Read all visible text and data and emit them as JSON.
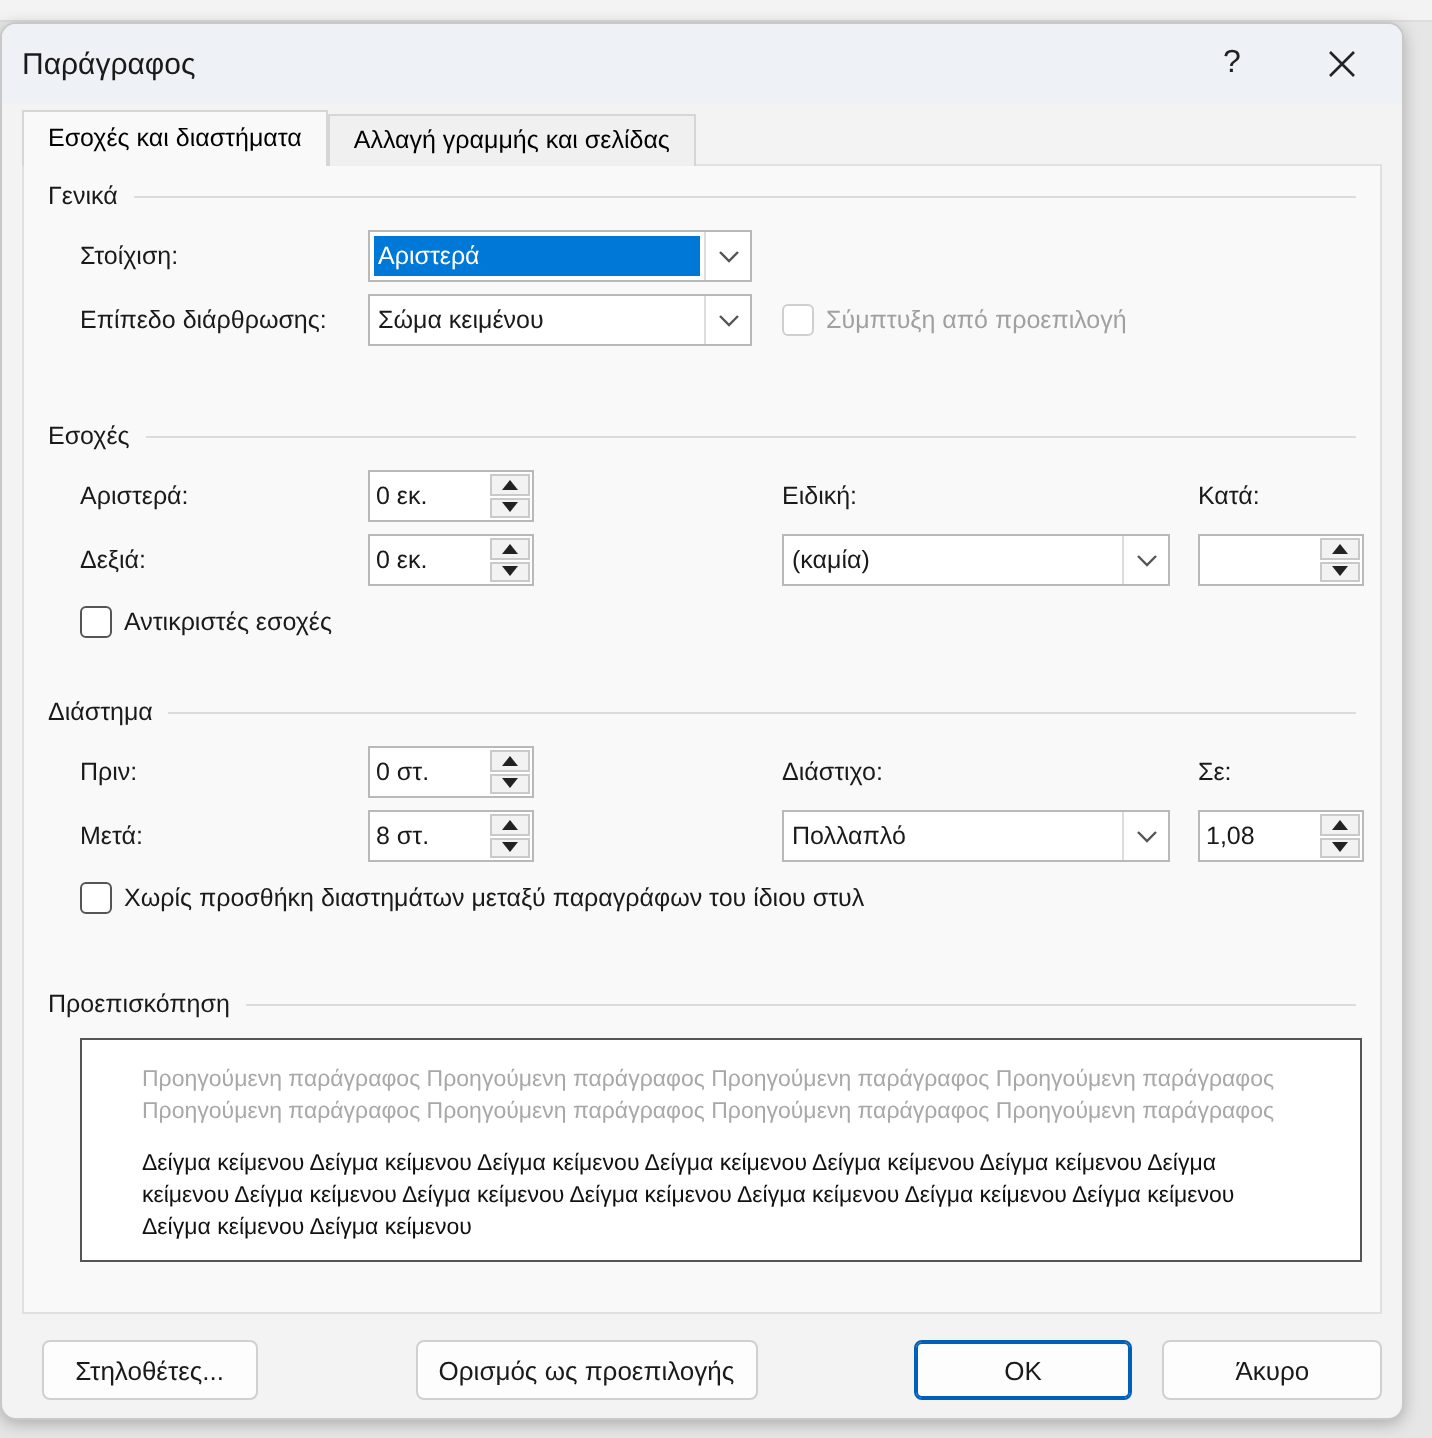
{
  "window": {
    "title": "Παράγραφος",
    "help": "?"
  },
  "tabs": [
    {
      "label": "Εσοχές και διαστήματα",
      "selected": true
    },
    {
      "label": "Αλλαγή γραμμής και σελίδας",
      "selected": false
    }
  ],
  "general": {
    "heading": "Γενικά",
    "alignment": {
      "label": "Στοίχιση:",
      "value": "Αριστερά",
      "focused": true
    },
    "outline_level": {
      "label": "Επίπεδο διάρθρωσης:",
      "value": "Σώμα κειμένου",
      "focused": false
    },
    "collapse": {
      "label": "Σύμπτυξη από προεπιλογή",
      "checked": false,
      "disabled": true
    }
  },
  "indentation": {
    "heading": "Εσοχές",
    "left": {
      "label": "Αριστερά:",
      "value": "0 εκ."
    },
    "right": {
      "label": "Δεξιά:",
      "value": "0 εκ."
    },
    "special": {
      "label": "Ειδική:",
      "value": "(καμία)",
      "focused": false
    },
    "by": {
      "label": "Κατά:"
    },
    "mirror": {
      "label": "Αντικριστές εσοχές",
      "checked": false,
      "disabled": false
    }
  },
  "spacing": {
    "heading": "Διάστημα",
    "before": {
      "label": "Πριν:",
      "value": "0 στ."
    },
    "after": {
      "label": "Μετά:",
      "value": "8 στ."
    },
    "line_spacing": {
      "label": "Διάστιχο:",
      "value": "Πολλαπλό",
      "focused": false
    },
    "at": {
      "label": "Σε:",
      "value": "1,08"
    },
    "no_space": {
      "label": "Χωρίς προσθήκη διαστημάτων μεταξύ παραγράφων του ίδιου στυλ",
      "checked": false,
      "disabled": false
    }
  },
  "preview": {
    "heading": "Προεπισκόπηση",
    "previous": "Προηγούμενη παράγραφος Προηγούμενη παράγραφος Προηγούμενη παράγραφος Προηγούμενη παράγραφος Προηγούμενη παράγραφος Προηγούμενη παράγραφος Προηγούμενη παράγραφος Προηγούμενη παράγραφος",
    "sample": "Δείγμα κείμενου Δείγμα κείμενου Δείγμα κείμενου Δείγμα κείμενου Δείγμα κείμενου Δείγμα κείμενου Δείγμα κείμενου Δείγμα κείμενου Δείγμα κείμενου Δείγμα κείμενου Δείγμα κείμενου Δείγμα κείμενου Δείγμα κείμενου Δείγμα κείμενου Δείγμα κείμενου"
  },
  "buttons": [
    {
      "label": "Στηλοθέτες...",
      "default": false
    },
    {
      "label": "Ορισμός ως προεπιλογής",
      "default": false
    },
    {
      "label": "OK",
      "default": true
    },
    {
      "label": "Άκυρο",
      "default": false
    }
  ]
}
